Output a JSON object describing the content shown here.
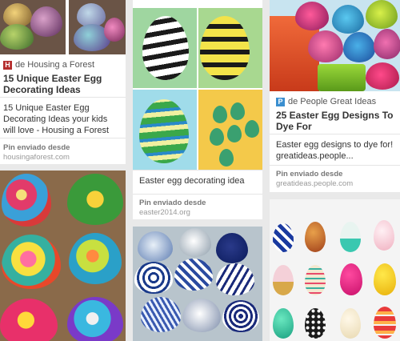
{
  "pins": [
    {
      "source": "de Housing a Forest",
      "source_icon": "H",
      "title": "15 Unique Easter Egg Decorating Ideas",
      "description": "15 Unique Easter Egg Decorating Ideas your kids will love - Housing a Forest",
      "credit_label": "Pin enviado desde",
      "credit_domain": "housingaforest.com"
    },
    {
      "description": "Easter egg decorating idea",
      "credit_label": "Pin enviado desde",
      "credit_domain": "easter2014.org"
    },
    {
      "source": "de People Great Ideas",
      "source_icon": "P",
      "title": "25 Easter Egg Designs To Dye For",
      "description": "Easter egg designs to dye for! greatideas.people...",
      "credit_label": "Pin enviado desde",
      "credit_domain": "greatideas.people.com"
    }
  ],
  "colors": {
    "housing_icon": "#b52d2d",
    "people_icon": "#3b8fd0"
  }
}
